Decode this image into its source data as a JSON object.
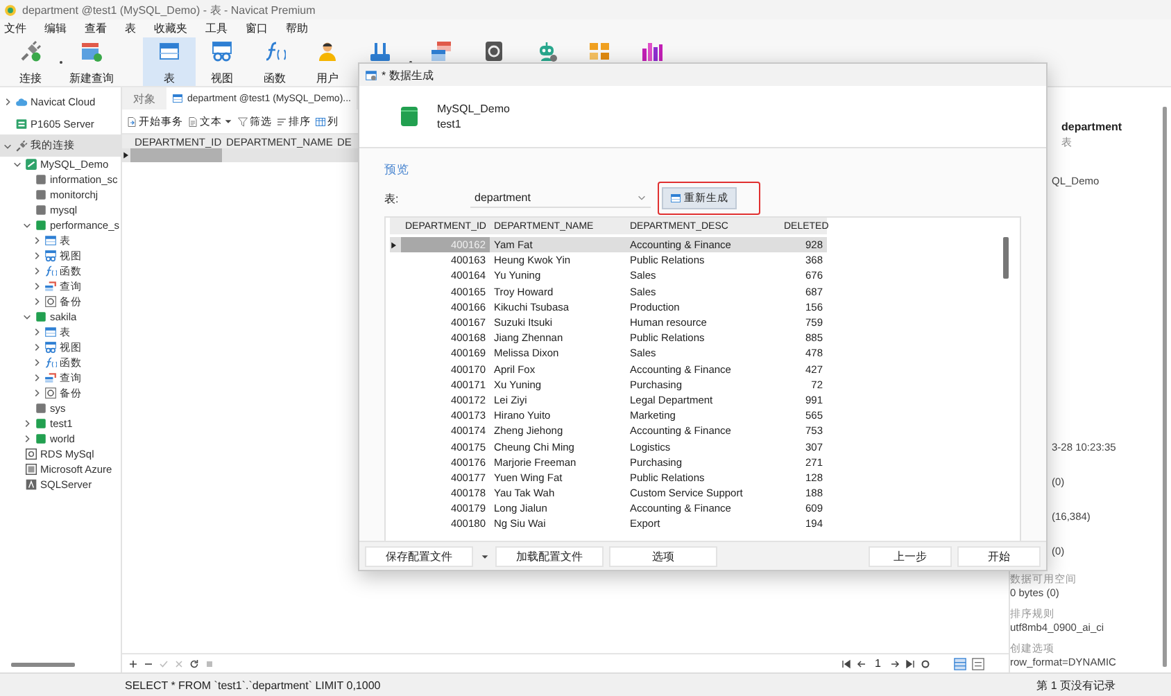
{
  "window": {
    "title": "department @test1 (MySQL_Demo) - 表 - Navicat Premium"
  },
  "menu": [
    "文件",
    "编辑",
    "查看",
    "表",
    "收藏夹",
    "工具",
    "窗口",
    "帮助"
  ],
  "toolbar": [
    {
      "label": "连接",
      "kind": "connect",
      "dropdown": true,
      "selected": false
    },
    {
      "label": "新建查询",
      "kind": "newquery",
      "dropdown": false,
      "selected": false
    },
    {
      "label": "表",
      "kind": "table",
      "dropdown": false,
      "selected": true
    },
    {
      "label": "视图",
      "kind": "view",
      "dropdown": false,
      "selected": false
    },
    {
      "label": "函数",
      "kind": "func",
      "dropdown": false,
      "selected": false
    },
    {
      "label": "用户",
      "kind": "user",
      "dropdown": false,
      "selected": false
    },
    {
      "kind": "tool",
      "dropdown": true,
      "selected": false
    },
    {
      "kind": "model",
      "dropdown": false,
      "selected": false
    },
    {
      "kind": "backup",
      "dropdown": false,
      "selected": false
    },
    {
      "kind": "robot",
      "dropdown": false,
      "selected": false
    },
    {
      "kind": "boxes",
      "dropdown": false,
      "selected": false
    },
    {
      "kind": "chart",
      "dropdown": false,
      "selected": false
    }
  ],
  "sidebar": {
    "tree": [
      {
        "label": "Navicat Cloud",
        "kind": "cloud",
        "expanded": false,
        "selected": false
      },
      {
        "label": "P1605 Server",
        "kind": "server",
        "selected": false
      },
      {
        "label": "我的连接",
        "kind": "group",
        "expanded": true,
        "selected": true,
        "children": [
          {
            "label": "MySQL_Demo",
            "kind": "connection",
            "expanded": true,
            "selected": false,
            "children": [
              {
                "label": "information_sc",
                "kind": "database",
                "open": false,
                "selected": false
              },
              {
                "label": "monitorchj",
                "kind": "database",
                "open": false,
                "selected": false
              },
              {
                "label": "mysql",
                "kind": "database",
                "open": false,
                "selected": false
              },
              {
                "label": "performance_s",
                "kind": "database",
                "open": true,
                "expanded": true,
                "selected": false,
                "children": [
                  {
                    "label": "表",
                    "kind": "tables",
                    "expanded": false,
                    "selected": false
                  },
                  {
                    "label": "视图",
                    "kind": "views",
                    "expanded": false,
                    "selected": false
                  },
                  {
                    "label": "函数",
                    "kind": "functions",
                    "expanded": false,
                    "selected": false
                  },
                  {
                    "label": "查询",
                    "kind": "queries",
                    "expanded": false,
                    "selected": false
                  },
                  {
                    "label": "备份",
                    "kind": "backups",
                    "expanded": false,
                    "selected": false
                  }
                ]
              },
              {
                "label": "sakila",
                "kind": "database",
                "open": true,
                "expanded": true,
                "selected": false,
                "children": [
                  {
                    "label": "表",
                    "kind": "tables",
                    "expanded": false,
                    "selected": false
                  },
                  {
                    "label": "视图",
                    "kind": "views",
                    "expanded": false,
                    "selected": false
                  },
                  {
                    "label": "函数",
                    "kind": "functions",
                    "expanded": false,
                    "selected": false
                  },
                  {
                    "label": "查询",
                    "kind": "queries",
                    "expanded": false,
                    "selected": false
                  },
                  {
                    "label": "备份",
                    "kind": "backups",
                    "expanded": false,
                    "selected": false
                  }
                ]
              },
              {
                "label": "sys",
                "kind": "database",
                "open": false,
                "selected": false
              },
              {
                "label": "test1",
                "kind": "database",
                "open": true,
                "expanded": false,
                "selected": false
              },
              {
                "label": "world",
                "kind": "database",
                "open": true,
                "expanded": false,
                "selected": false
              }
            ]
          },
          {
            "label": "RDS MySql",
            "kind": "rds",
            "selected": false
          },
          {
            "label": "Microsoft Azure",
            "kind": "azure",
            "selected": false
          },
          {
            "label": "SQLServer",
            "kind": "sqlserver",
            "selected": false
          }
        ]
      }
    ]
  },
  "main": {
    "tabs": [
      {
        "label": "对象",
        "kind": "objects",
        "selected": false
      },
      {
        "label": "department @test1 (MySQL_Demo)...",
        "kind": "table",
        "selected": true
      }
    ],
    "actions": [
      {
        "label": "开始事务",
        "kind": "transaction",
        "dropdown": false
      },
      {
        "label": "文本",
        "kind": "text",
        "dropdown": true
      },
      {
        "label": "筛选",
        "kind": "filter",
        "dropdown": false
      },
      {
        "label": "排序",
        "kind": "sort",
        "dropdown": false
      },
      {
        "label": "列",
        "kind": "columns",
        "dropdown": false
      }
    ],
    "grid": {
      "columns": [
        "DEPARTMENT_ID",
        "DEPARTMENT_NAME",
        "DE"
      ],
      "rows": [
        {
          "selected": true
        }
      ]
    },
    "grid_tools": [
      {
        "kind": "add",
        "disabled": false
      },
      {
        "kind": "delete",
        "disabled": false
      },
      {
        "kind": "apply",
        "disabled": true
      },
      {
        "kind": "discard",
        "disabled": true
      },
      {
        "kind": "refresh",
        "disabled": false
      },
      {
        "kind": "stop",
        "disabled": true
      }
    ],
    "pager": {
      "page": "1"
    }
  },
  "info_panel": {
    "title": "department",
    "subtitle": "表",
    "fields": [
      {
        "kind": "partial",
        "value": "QL_Demo"
      },
      {
        "kind": "partial",
        "value": "3-28 10:23:35"
      },
      {
        "kind": "partial",
        "value": "(0)"
      },
      {
        "kind": "partial",
        "value": "(16,384)"
      },
      {
        "kind": "partial",
        "value": "(0)"
      },
      {
        "kind": "full",
        "label": "数据可用空间",
        "value": "0 bytes (0)"
      },
      {
        "kind": "full",
        "label": "排序规则",
        "value": "utf8mb4_0900_ai_ci"
      },
      {
        "kind": "full",
        "label": "创建选项",
        "value": "row_format=DYNAMIC"
      }
    ]
  },
  "status_bar": {
    "sql": "SELECT * FROM `test1`.`department` LIMIT 0,1000",
    "records": "第 1 页没有记录"
  },
  "dialog": {
    "title": "* 数据生成",
    "connection": "MySQL_Demo",
    "database": "test1",
    "section": "预览",
    "table_label": "表:",
    "table_value": "department",
    "regenerate": {
      "label": "重新生成",
      "highlighted": true
    },
    "grid": {
      "columns": [
        "DEPARTMENT_ID",
        "DEPARTMENT_NAME",
        "DEPARTMENT_DESC",
        "DELETED"
      ],
      "rows": [
        {
          "selected": true,
          "cells": [
            "400162",
            "Yam Fat",
            "Accounting & Finance",
            "928"
          ]
        },
        {
          "selected": false,
          "cells": [
            "400163",
            "Heung Kwok Yin",
            "Public Relations",
            "368"
          ]
        },
        {
          "selected": false,
          "cells": [
            "400164",
            "Yu Yuning",
            "Sales",
            "676"
          ]
        },
        {
          "selected": false,
          "cells": [
            "400165",
            "Troy Howard",
            "Sales",
            "687"
          ]
        },
        {
          "selected": false,
          "cells": [
            "400166",
            "Kikuchi Tsubasa",
            "Production",
            "156"
          ]
        },
        {
          "selected": false,
          "cells": [
            "400167",
            "Suzuki Itsuki",
            "Human resource",
            "759"
          ]
        },
        {
          "selected": false,
          "cells": [
            "400168",
            "Jiang Zhennan",
            "Public Relations",
            "885"
          ]
        },
        {
          "selected": false,
          "cells": [
            "400169",
            "Melissa Dixon",
            "Sales",
            "478"
          ]
        },
        {
          "selected": false,
          "cells": [
            "400170",
            "April Fox",
            "Accounting & Finance",
            "427"
          ]
        },
        {
          "selected": false,
          "cells": [
            "400171",
            "Xu Yuning",
            "Purchasing",
            "72"
          ]
        },
        {
          "selected": false,
          "cells": [
            "400172",
            "Lei Ziyi",
            "Legal Department",
            "991"
          ]
        },
        {
          "selected": false,
          "cells": [
            "400173",
            "Hirano Yuito",
            "Marketing",
            "565"
          ]
        },
        {
          "selected": false,
          "cells": [
            "400174",
            "Zheng Jiehong",
            "Accounting & Finance",
            "753"
          ]
        },
        {
          "selected": false,
          "cells": [
            "400175",
            "Cheung Chi Ming",
            "Logistics",
            "307"
          ]
        },
        {
          "selected": false,
          "cells": [
            "400176",
            "Marjorie Freeman",
            "Purchasing",
            "271"
          ]
        },
        {
          "selected": false,
          "cells": [
            "400177",
            "Yuen Wing Fat",
            "Public Relations",
            "128"
          ]
        },
        {
          "selected": false,
          "cells": [
            "400178",
            "Yau Tak Wah",
            "Custom Service Support",
            "188"
          ]
        },
        {
          "selected": false,
          "cells": [
            "400179",
            "Long Jialun",
            "Accounting & Finance",
            "609"
          ]
        },
        {
          "selected": false,
          "cells": [
            "400180",
            "Ng Siu Wai",
            "Export",
            "194"
          ]
        }
      ]
    },
    "footer_left": [
      {
        "label": "保存配置文件",
        "kind": "split"
      },
      {
        "label": "加载配置文件",
        "kind": "plain"
      },
      {
        "label": "选项",
        "kind": "plain"
      }
    ],
    "footer_right": [
      {
        "label": "上一步"
      },
      {
        "label": "开始"
      }
    ]
  }
}
